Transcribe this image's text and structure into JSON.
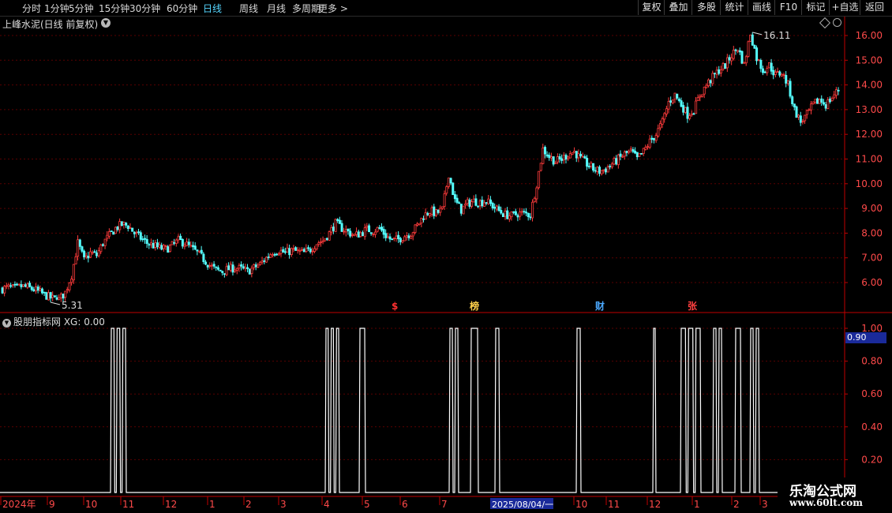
{
  "toolbar": {
    "timeframes": [
      {
        "label": "分时",
        "active": false
      },
      {
        "label": "1分钟",
        "active": false
      },
      {
        "label": "5分钟",
        "active": false
      },
      {
        "label": "15分钟",
        "active": false
      },
      {
        "label": "30分钟",
        "active": false
      },
      {
        "label": "60分钟",
        "active": false
      },
      {
        "label": "日线",
        "active": true
      },
      {
        "label": "周线",
        "active": false
      },
      {
        "label": "月线",
        "active": false
      },
      {
        "label": "多周期",
        "active": false
      },
      {
        "label": "更多 >",
        "active": false
      }
    ],
    "right_buttons": [
      "复权",
      "叠加",
      "多股",
      "统计",
      "画线",
      "F10",
      "标记",
      "+自选",
      "返回"
    ]
  },
  "main_panel": {
    "title": "上峰水泥(日线 前复权)",
    "high_label": "16.11",
    "low_label": "5.31",
    "price_axis": [
      "16.00",
      "15.00",
      "14.00",
      "13.00",
      "12.00",
      "11.00",
      "10.00",
      "9.00",
      "8.00",
      "7.00",
      "6.00"
    ],
    "event_markers": [
      {
        "text": "$",
        "color": "#ff3030"
      },
      {
        "text": "榜",
        "color": "#ffd04a"
      },
      {
        "text": "财",
        "color": "#4aa8ff"
      },
      {
        "text": "张",
        "color": "#ff4040"
      }
    ]
  },
  "indicator_panel": {
    "title": "股朋指标网 XG: 0.00",
    "axis": [
      "1.00",
      "0.80",
      "0.60",
      "0.40",
      "0.20"
    ],
    "current_value": "0.90"
  },
  "date_axis": {
    "labels": [
      "2024年",
      "9",
      "10",
      "11",
      "12",
      "1",
      "2",
      "3",
      "4",
      "5",
      "6",
      "7",
      "10",
      "11",
      "12",
      "1",
      "2",
      "3"
    ],
    "cursor_date": "2025/08/04/一"
  },
  "watermark": {
    "line1": "乐淘公式网",
    "line2": "www.60lt.com"
  },
  "colors": {
    "up": "#ff3b3b",
    "down": "#54ffff",
    "grid": "#5a0000",
    "axis": "#c00000",
    "signal": "#ffffff"
  },
  "chart_data": [
    {
      "type": "candlestick",
      "title": "上峰水泥(日线 前复权)",
      "ylim": [
        5.0,
        16.5
      ],
      "yticks": [
        6,
        7,
        8,
        9,
        10,
        11,
        12,
        13,
        14,
        15,
        16
      ],
      "annotations": [
        {
          "label": "16.11",
          "kind": "high"
        },
        {
          "label": "5.31",
          "kind": "low"
        }
      ],
      "trend": [
        5.75,
        5.8,
        5.75,
        5.85,
        5.8,
        5.72,
        5.6,
        5.45,
        5.35,
        5.31,
        5.6,
        6.3,
        7.6,
        6.9,
        7.2,
        7.1,
        7.6,
        7.9,
        8.2,
        8.35,
        8.3,
        8.0,
        7.8,
        7.6,
        7.5,
        7.4,
        7.35,
        7.5,
        7.7,
        7.6,
        7.4,
        7.2,
        6.95,
        6.7,
        6.5,
        6.45,
        6.55,
        6.6,
        6.55,
        6.45,
        6.6,
        6.75,
        7.0,
        7.25,
        7.3,
        7.2,
        7.3,
        7.25,
        7.2,
        7.35,
        7.6,
        7.7,
        8.0,
        8.4,
        8.2,
        8.05,
        7.9,
        8.0,
        8.15,
        8.1,
        8.2,
        7.9,
        7.7,
        7.75,
        7.9,
        8.0,
        8.3,
        8.7,
        8.9,
        8.8,
        8.95,
        10.4,
        9.3,
        8.95,
        9.2,
        9.3,
        9.25,
        9.3,
        9.1,
        8.9,
        8.75,
        8.7,
        8.8,
        8.8,
        8.75,
        10.0,
        11.4,
        11.1,
        10.9,
        11.0,
        11.2,
        11.3,
        11.0,
        10.8,
        10.6,
        10.5,
        10.6,
        10.8,
        11.0,
        11.2,
        11.3,
        11.0,
        11.3,
        11.7,
        12.0,
        12.5,
        13.3,
        13.6,
        13.2,
        12.8,
        13.0,
        13.6,
        14.0,
        14.3,
        14.6,
        14.8,
        15.2,
        15.5,
        14.8,
        16.11,
        15.1,
        14.6,
        14.8,
        14.4,
        14.5,
        14.0,
        13.0,
        12.5,
        12.8,
        13.2,
        13.4,
        13.2,
        13.5,
        13.8
      ]
    },
    {
      "type": "line",
      "title": "股朋指标网 XG: 0.00",
      "ylim": [
        0,
        1.0
      ],
      "yticks": [
        0.2,
        0.4,
        0.6,
        0.8,
        1.0
      ],
      "signal_groups": [
        {
          "start": 140,
          "width": 22,
          "n": 3
        },
        {
          "start": 412,
          "width": 20,
          "n": 3
        },
        {
          "start": 455,
          "width": 10,
          "n": 1
        },
        {
          "start": 569,
          "width": 14,
          "n": 2
        },
        {
          "start": 596,
          "width": 12,
          "n": 1
        },
        {
          "start": 627,
          "width": 8,
          "n": 1
        },
        {
          "start": 730,
          "width": 8,
          "n": 1
        },
        {
          "start": 827,
          "width": 6,
          "n": 1
        },
        {
          "start": 862,
          "width": 28,
          "n": 3
        },
        {
          "start": 903,
          "width": 14,
          "n": 2
        },
        {
          "start": 931,
          "width": 10,
          "n": 1
        },
        {
          "start": 950,
          "width": 14,
          "n": 2
        }
      ],
      "current_value": "0.90"
    }
  ]
}
